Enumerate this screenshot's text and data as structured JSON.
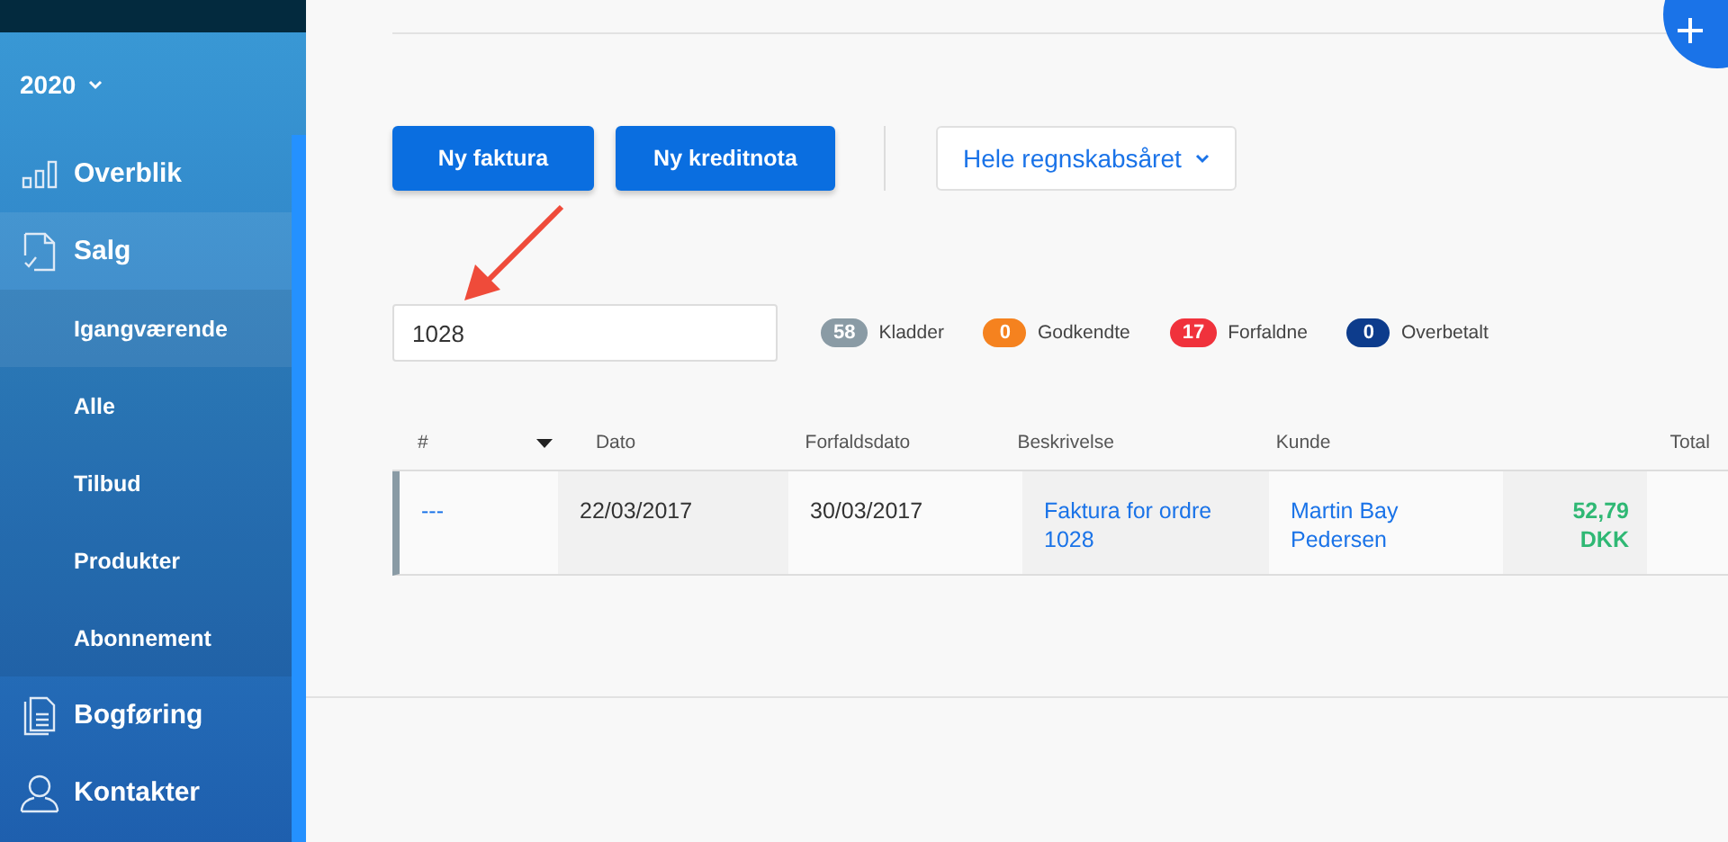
{
  "sidebar": {
    "year": "2020",
    "nav": [
      {
        "label": "Overblik",
        "selected": false
      },
      {
        "label": "Salg",
        "selected": true,
        "children": [
          {
            "label": "Igangværende",
            "selected": true
          },
          {
            "label": "Alle",
            "selected": false
          },
          {
            "label": "Tilbud",
            "selected": false
          },
          {
            "label": "Produkter",
            "selected": false
          },
          {
            "label": "Abonnement",
            "selected": false
          }
        ]
      },
      {
        "label": "Bogføring",
        "selected": false
      },
      {
        "label": "Kontakter",
        "selected": false
      }
    ]
  },
  "toolbar": {
    "buttons": [
      "Ny faktura",
      "Ny kreditnota"
    ],
    "period": "Hele regnskabsåret"
  },
  "search": {
    "value": "1028"
  },
  "statuses": [
    {
      "count": "58",
      "label": "Kladder",
      "color": "#8a9ba5"
    },
    {
      "count": "0",
      "label": "Godkendte",
      "color": "#f5821f"
    },
    {
      "count": "17",
      "label": "Forfaldne",
      "color": "#f0323c"
    },
    {
      "count": "0",
      "label": "Overbetalt",
      "color": "#0d3c8c"
    }
  ],
  "table": {
    "columns": [
      "#",
      "Dato",
      "Forfaldsdato",
      "Beskrivelse",
      "Kunde",
      "Total"
    ],
    "rows": [
      {
        "color": "#8a9ba5",
        "cells": [
          "---",
          "22/03/2017",
          "30/03/2017",
          "Faktura for ordre 1028",
          "Martin Bay Pedersen",
          "52,79 DKK"
        ]
      }
    ]
  }
}
